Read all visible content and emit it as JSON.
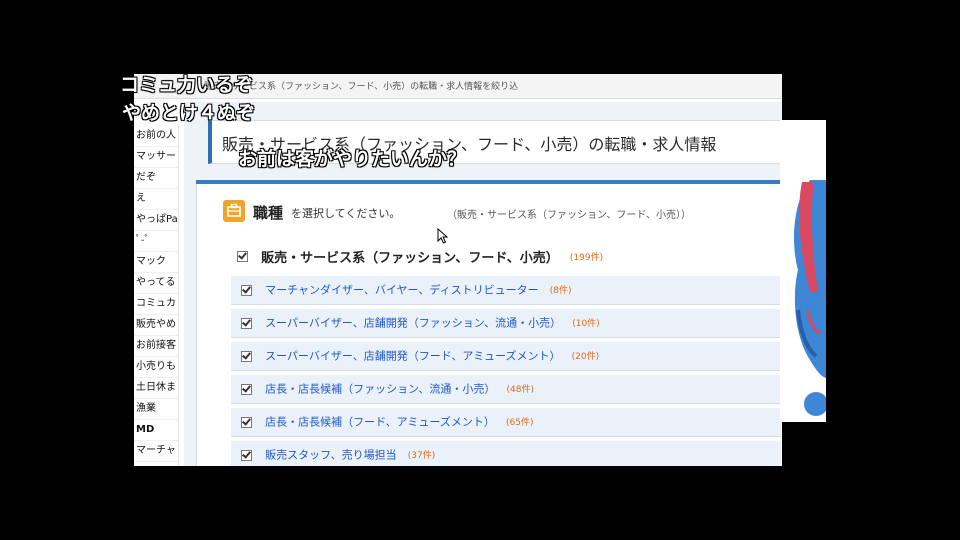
{
  "page": {
    "breadcrumb": "販売・サービス系（ファッション、フード、小売）の転職・求人情報を絞り込",
    "title": "販売・サービス系（ファッション、フード、小売）の転職・求人情報",
    "heading_bold": "職種",
    "heading_rest": "を選択してください。",
    "heading_note": "（販売・サービス系（ファッション、フード、小売））",
    "parent": {
      "label": "販売・サービス系（ファッション、フード、小売）",
      "count": "(199件)"
    },
    "sub_items": [
      {
        "label": "マーチャンダイザー、バイヤー、ディストリビューター",
        "count": "(8件)"
      },
      {
        "label": "スーパーバイザー、店舗開発（ファッション、流通・小売）",
        "count": "(10件)"
      },
      {
        "label": "スーパーバイザー、店舗開発（フード、アミューズメント）",
        "count": "(20件)"
      },
      {
        "label": "店長・店長候補（ファッション、流通・小売）",
        "count": "(48件)"
      },
      {
        "label": "店長・店長候補（フード、アミューズメント）",
        "count": "(65件)"
      },
      {
        "label": "販売スタッフ、売り場担当",
        "count": "(37件)"
      }
    ]
  },
  "sidebar": {
    "items": [
      "お前の人",
      "マッサー",
      "だぞ",
      "え",
      "やっぱPa",
      "ﾟ-ﾟ",
      "マック",
      "やってる",
      "コミュカ",
      "販売やめ",
      "お前接客",
      "小売りも",
      "土日休ま",
      "漁業",
      "MD",
      "マーチャ"
    ]
  },
  "comments": {
    "c1": "コミュ力いるぞ",
    "c2": "やめとけ４ぬぞ",
    "c3": "お前は客がやりたいんか？"
  },
  "colors": {
    "accent_blue": "#2a6fb7",
    "link_blue": "#1f58c8",
    "count_orange": "#e06a1a",
    "icon_orange": "#f0a52a"
  },
  "icons": {
    "category": "briefcase-icon",
    "cursor": "mouse-cursor-icon",
    "checkbox": "checkbox-checked-icon"
  }
}
